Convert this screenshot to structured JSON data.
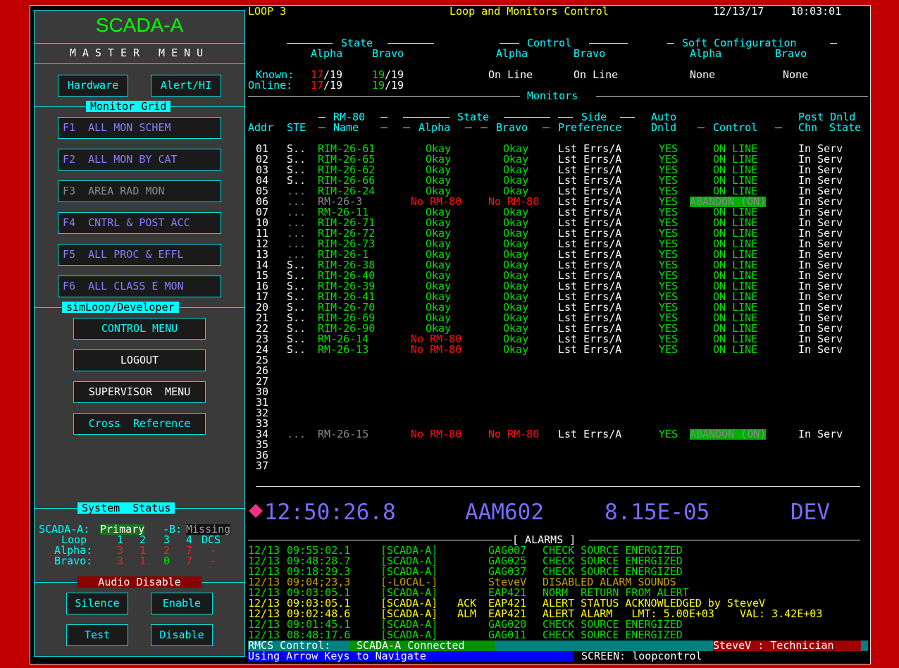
{
  "header": {
    "loop": "LOOP 3",
    "title": "Loop and Monitors Control",
    "date": "12/13/17",
    "time": "10:03:01"
  },
  "sidebar": {
    "brand": "SCADA-A",
    "master_menu": "MASTER MENU",
    "hardware": "Hardware",
    "alert": "Alert/HI",
    "monitor_grid": "Monitor Grid",
    "grid_items": [
      "F1  ALL MON SCHEM",
      "F2  ALL MON BY CAT",
      "F3  AREA RAD MON",
      "F4  CNTRL & POST ACC",
      "F5  ALL PROC & EFFL",
      "F6  ALL CLASS E MON"
    ],
    "simloop": "simLoop/Developer",
    "control_menu": "CONTROL MENU",
    "logout": "LOGOUT",
    "supervisor": "SUPERVISOR  MENU",
    "cross_ref": "Cross  Reference",
    "system_status": "System  Status",
    "scada_a_label": "SCADA-A:",
    "scada_a_val": "Primary",
    "b_label": "-B:",
    "b_val": "Missing",
    "loop_label": "Loop",
    "loop_cols": [
      "1",
      "2",
      "3",
      "4",
      "DCS"
    ],
    "alpha_label": "Alpha:",
    "alpha_vals": [
      "3",
      "1",
      "2",
      "7",
      "-"
    ],
    "bravo_label": "Bravo:",
    "bravo_vals": [
      "3",
      "1",
      "0",
      "7",
      "-"
    ],
    "audio_disable": "Audio Disable",
    "silence": "Silence",
    "enable": "Enable",
    "test": "Test",
    "disable": "Disable"
  },
  "summary": {
    "state_label": "State",
    "control_label": "Control",
    "softcfg_label": "Soft Configuration",
    "alpha": "Alpha",
    "bravo": "Bravo",
    "known_label": "Known:",
    "online_label": "Online:",
    "known_alpha_num": "17",
    "known_alpha_den": "/19",
    "known_bravo_num": "19",
    "known_bravo_den": "/19",
    "online_alpha_num": "17",
    "online_alpha_den": "/19",
    "online_bravo_num": "19",
    "online_bravo_den": "/19",
    "control_alpha": "On Line",
    "control_bravo": "On Line",
    "soft_alpha": "None",
    "soft_bravo": "None"
  },
  "monitors": {
    "title": "Monitors",
    "col_headers": {
      "rm80": "RM-80",
      "state": "State",
      "side": "Side",
      "auto": "Auto",
      "postdnld": "Post Dnld",
      "addr": "Addr",
      "ste": "STE",
      "name": "Name",
      "alpha": "Alpha",
      "bravo": "Bravo",
      "preference": "Preference",
      "dnld": "Dnld",
      "control": "Control",
      "chn": "Chn",
      "stateh": "State"
    },
    "rows": [
      {
        "addr": "01",
        "ste": "S..",
        "name": "RIM-26-61",
        "alpha": "Okay",
        "bravo": "Okay",
        "pref": "Lst Errs/A",
        "auto": "YES",
        "control": "ON LINE",
        "post": "In Serv",
        "kind": "ok"
      },
      {
        "addr": "02",
        "ste": "S..",
        "name": "RIM-26-65",
        "alpha": "Okay",
        "bravo": "Okay",
        "pref": "Lst Errs/A",
        "auto": "YES",
        "control": "ON LINE",
        "post": "In Serv",
        "kind": "ok"
      },
      {
        "addr": "03",
        "ste": "S..",
        "name": "RIM-26-62",
        "alpha": "Okay",
        "bravo": "Okay",
        "pref": "Lst Errs/A",
        "auto": "YES",
        "control": "ON LINE",
        "post": "In Serv",
        "kind": "ok"
      },
      {
        "addr": "04",
        "ste": "S..",
        "name": "RIM-26-66",
        "alpha": "Okay",
        "bravo": "Okay",
        "pref": "Lst Errs/A",
        "auto": "YES",
        "control": "ON LINE",
        "post": "In Serv",
        "kind": "ok"
      },
      {
        "addr": "05",
        "ste": "...",
        "name": "RIM-26-24",
        "alpha": "Okay",
        "bravo": "Okay",
        "pref": "Lst Errs/A",
        "auto": "YES",
        "control": "ON LINE",
        "post": "In Serv",
        "kind": "ok"
      },
      {
        "addr": "06",
        "ste": "...",
        "name": "RM-26-3",
        "alpha": "No RM-80",
        "bravo": "No RM-80",
        "pref": "Lst Errs/A",
        "auto": "YES",
        "control": "ABANDON (ON)",
        "post": "In Serv",
        "kind": "abandon"
      },
      {
        "addr": "07",
        "ste": "...",
        "name": "RM-26-11",
        "alpha": "Okay",
        "bravo": "Okay",
        "pref": "Lst Errs/A",
        "auto": "YES",
        "control": "ON LINE",
        "post": "In Serv",
        "kind": "ok"
      },
      {
        "addr": "10",
        "ste": "...",
        "name": "RIM-26-71",
        "alpha": "Okay",
        "bravo": "Okay",
        "pref": "Lst Errs/A",
        "auto": "YES",
        "control": "ON LINE",
        "post": "In Serv",
        "kind": "ok"
      },
      {
        "addr": "11",
        "ste": "...",
        "name": "RIM-26-72",
        "alpha": "Okay",
        "bravo": "Okay",
        "pref": "Lst Errs/A",
        "auto": "YES",
        "control": "ON LINE",
        "post": "In Serv",
        "kind": "ok"
      },
      {
        "addr": "12",
        "ste": "...",
        "name": "RIM-26-73",
        "alpha": "Okay",
        "bravo": "Okay",
        "pref": "Lst Errs/A",
        "auto": "YES",
        "control": "ON LINE",
        "post": "In Serv",
        "kind": "ok"
      },
      {
        "addr": "13",
        "ste": "...",
        "name": "RIM-26-1",
        "alpha": "Okay",
        "bravo": "Okay",
        "pref": "Lst Errs/A",
        "auto": "YES",
        "control": "ON LINE",
        "post": "In Serv",
        "kind": "ok"
      },
      {
        "addr": "14",
        "ste": "S..",
        "name": "RIM-26-38",
        "alpha": "Okay",
        "bravo": "Okay",
        "pref": "Lst Errs/A",
        "auto": "YES",
        "control": "ON LINE",
        "post": "In Serv",
        "kind": "ok"
      },
      {
        "addr": "15",
        "ste": "S..",
        "name": "RIM-26-40",
        "alpha": "Okay",
        "bravo": "Okay",
        "pref": "Lst Errs/A",
        "auto": "YES",
        "control": "ON LINE",
        "post": "In Serv",
        "kind": "ok"
      },
      {
        "addr": "16",
        "ste": "S..",
        "name": "RIM-26-39",
        "alpha": "Okay",
        "bravo": "Okay",
        "pref": "Lst Errs/A",
        "auto": "YES",
        "control": "ON LINE",
        "post": "In Serv",
        "kind": "ok"
      },
      {
        "addr": "17",
        "ste": "S..",
        "name": "RIM-26-41",
        "alpha": "Okay",
        "bravo": "Okay",
        "pref": "Lst Errs/A",
        "auto": "YES",
        "control": "ON LINE",
        "post": "In Serv",
        "kind": "ok"
      },
      {
        "addr": "20",
        "ste": "S..",
        "name": "RIM-26-70",
        "alpha": "Okay",
        "bravo": "Okay",
        "pref": "Lst Errs/A",
        "auto": "YES",
        "control": "ON LINE",
        "post": "In Serv",
        "kind": "ok"
      },
      {
        "addr": "21",
        "ste": "S..",
        "name": "RIM-26-69",
        "alpha": "Okay",
        "bravo": "Okay",
        "pref": "Lst Errs/A",
        "auto": "YES",
        "control": "ON LINE",
        "post": "In Serv",
        "kind": "ok"
      },
      {
        "addr": "22",
        "ste": "S..",
        "name": "RIM-26-90",
        "alpha": "Okay",
        "bravo": "Okay",
        "pref": "Lst Errs/A",
        "auto": "YES",
        "control": "ON LINE",
        "post": "In Serv",
        "kind": "ok"
      },
      {
        "addr": "23",
        "ste": "S..",
        "name": "RM-26-14",
        "alpha": "No RM-80",
        "bravo": "Okay",
        "pref": "Lst Errs/A",
        "auto": "YES",
        "control": "ON LINE",
        "post": "In Serv",
        "kind": "ok"
      },
      {
        "addr": "24",
        "ste": "S..",
        "name": "RM-26-13",
        "alpha": "No RM-80",
        "bravo": "Okay",
        "pref": "Lst Errs/A",
        "auto": "YES",
        "control": "ON LINE",
        "post": "In Serv",
        "kind": "ok"
      },
      {
        "addr": "25"
      },
      {
        "addr": "26"
      },
      {
        "addr": "27"
      },
      {
        "addr": "30"
      },
      {
        "addr": "31"
      },
      {
        "addr": "32"
      },
      {
        "addr": "33"
      },
      {
        "addr": "34",
        "ste": "...",
        "name": "RM-26-15",
        "alpha": "No RM-80",
        "bravo": "No RM-80",
        "pref": "Lst Errs/A",
        "auto": "YES",
        "control": "ABANDON (ON)",
        "post": "In Serv",
        "kind": "abandon"
      },
      {
        "addr": "35"
      },
      {
        "addr": "36"
      },
      {
        "addr": "37"
      }
    ]
  },
  "readout": {
    "clock": "12:50:26.8",
    "tag": "AAM602",
    "value": "8.15E-05",
    "mode": "DEV"
  },
  "alarms": {
    "title": "[ ALARMS ]",
    "rows": [
      {
        "date": "12/13",
        "time": "09:55:02.1",
        "src": "[SCADA-A]",
        "ack": "",
        "code": "GAG007",
        "msg": "CHECK SOURCE ENERGIZED",
        "color": "g"
      },
      {
        "date": "12/13",
        "time": "09:48:28.7",
        "src": "[SCADA-A]",
        "ack": "",
        "code": "GAG025",
        "msg": "CHECK SOURCE ENERGIZED",
        "color": "g"
      },
      {
        "date": "12/13",
        "time": "09:18:29.3",
        "src": "[SCADA-A]",
        "ack": "",
        "code": "GAG037",
        "msg": "CHECK SOURCE ENERGIZED",
        "color": "g"
      },
      {
        "date": "12/13",
        "time": "09;04;23,3",
        "src": "[-LOCAL-]",
        "ack": "",
        "code": "SteveV",
        "msg": "DISABLED ALARM SOUNDS",
        "color": "or"
      },
      {
        "date": "12/13",
        "time": "09:03:05.1",
        "src": "[SCADA-A]",
        "ack": "",
        "code": "EAP421",
        "msg": "NORM  RETURN FROM ALERT",
        "color": "g"
      },
      {
        "date": "12/13",
        "time": "09:03:05.1",
        "src": "[SCADA-A]",
        "ack": "ACK",
        "code": "EAP421",
        "msg": "ALERT STATUS ACKNOWLEDGED by SteveV",
        "color": "y"
      },
      {
        "date": "12/13",
        "time": "09:02:48.6",
        "src": "[SCADA-A]",
        "ack": "ALM",
        "code": "EAP421",
        "msg": "ALERT ALARM   LMT: 5.00E+03    VAL: 3.42E+03",
        "color": "y"
      },
      {
        "date": "12/13",
        "time": "09:01:45.1",
        "src": "[SCADA-A]",
        "ack": "",
        "code": "GAG020",
        "msg": "CHECK SOURCE ENERGIZED",
        "color": "g"
      },
      {
        "date": "12/13",
        "time": "08:48:17.6",
        "src": "[SCADA-A]",
        "ack": "",
        "code": "GAG011",
        "msg": "CHECK SOURCE ENERGIZED",
        "color": "g"
      }
    ]
  },
  "status_bar": {
    "rmcs_label": "RMCS Control:",
    "rmcs_value": "SCADA-A Connected",
    "user": "SteveV : Technician",
    "hint": "Using Arrow Keys to Navigate",
    "screen": "SCREEN: loopcontrol"
  },
  "colors": {
    "accent": "#00ffff",
    "ok": "#00e000",
    "alarm": "#ff1010",
    "warn": "#ffff00",
    "background": "#c00000"
  }
}
